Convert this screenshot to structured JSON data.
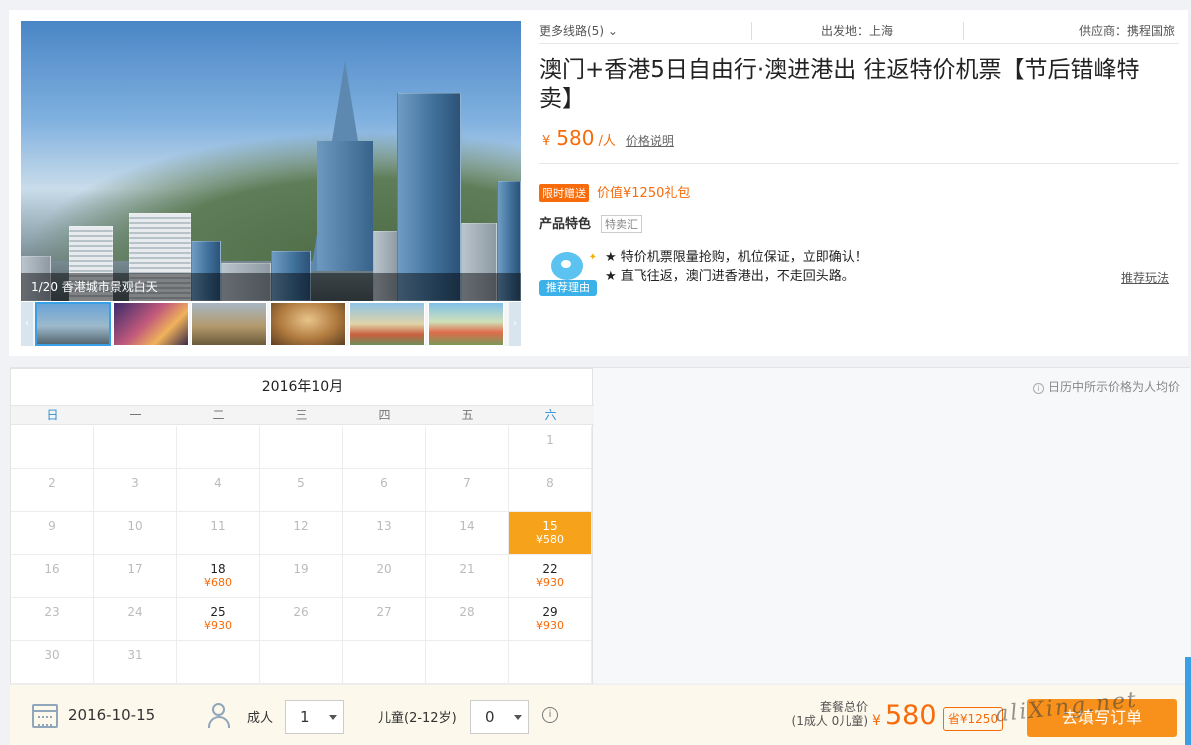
{
  "product": {
    "hero_caption": "1/20 香港城市景观白天",
    "more_routes": "更多线路(5)",
    "depart": "出发地：上海",
    "supplier": "供应商：携程国旅",
    "title": "澳门+香港5日自由行·澳进港出 往返特价机票【节后错峰特卖】",
    "price_symbol": "¥",
    "price": "580",
    "price_unit": "/人",
    "price_explain": "价格说明",
    "gift_tag": "限时赠送",
    "gift_text": "价值¥1250礼包",
    "feature_label": "产品特色",
    "feature_tag": "特卖汇",
    "reason_badge": "推荐理由",
    "reasons": [
      "★ 特价机票限量抢购，机位保证，立即确认！",
      "★ 直飞往返，澳门进香港出，不走回头路。"
    ],
    "recommend_link": "推荐玩法",
    "thumbnail_icons": [
      "skyline-thumb",
      "nightlife-thumb",
      "harbor-thumb",
      "ruins-thumb",
      "parade-thumb",
      "park-thumb"
    ]
  },
  "calendar": {
    "month_title": "2016年10月",
    "weekdays": [
      "日",
      "一",
      "二",
      "三",
      "四",
      "五",
      "六"
    ],
    "note": "日历中所示价格为人均价",
    "days": [
      {
        "d": "",
        "p": ""
      },
      {
        "d": "",
        "p": ""
      },
      {
        "d": "",
        "p": ""
      },
      {
        "d": "",
        "p": ""
      },
      {
        "d": "",
        "p": ""
      },
      {
        "d": "",
        "p": ""
      },
      {
        "d": "1",
        "p": ""
      },
      {
        "d": "2",
        "p": ""
      },
      {
        "d": "3",
        "p": ""
      },
      {
        "d": "4",
        "p": ""
      },
      {
        "d": "5",
        "p": ""
      },
      {
        "d": "6",
        "p": ""
      },
      {
        "d": "7",
        "p": ""
      },
      {
        "d": "8",
        "p": ""
      },
      {
        "d": "9",
        "p": ""
      },
      {
        "d": "10",
        "p": ""
      },
      {
        "d": "11",
        "p": ""
      },
      {
        "d": "12",
        "p": ""
      },
      {
        "d": "13",
        "p": ""
      },
      {
        "d": "14",
        "p": ""
      },
      {
        "d": "15",
        "p": "¥580",
        "selected": true
      },
      {
        "d": "16",
        "p": ""
      },
      {
        "d": "17",
        "p": ""
      },
      {
        "d": "18",
        "p": "¥680"
      },
      {
        "d": "19",
        "p": ""
      },
      {
        "d": "20",
        "p": ""
      },
      {
        "d": "21",
        "p": ""
      },
      {
        "d": "22",
        "p": "¥930"
      },
      {
        "d": "23",
        "p": ""
      },
      {
        "d": "24",
        "p": ""
      },
      {
        "d": "25",
        "p": "¥930"
      },
      {
        "d": "26",
        "p": ""
      },
      {
        "d": "27",
        "p": ""
      },
      {
        "d": "28",
        "p": ""
      },
      {
        "d": "29",
        "p": "¥930"
      },
      {
        "d": "30",
        "p": ""
      },
      {
        "d": "31",
        "p": ""
      },
      {
        "d": "",
        "p": ""
      },
      {
        "d": "",
        "p": ""
      },
      {
        "d": "",
        "p": ""
      },
      {
        "d": "",
        "p": ""
      },
      {
        "d": "",
        "p": ""
      }
    ]
  },
  "booking": {
    "date": "2016-10-15",
    "adult_label": "成人",
    "adult_value": "1",
    "child_label": "儿童(2-12岁)",
    "child_value": "0",
    "total_label": "套餐总价",
    "total_sub": "(1成人 0儿童)",
    "total_symbol": "¥",
    "total": "580",
    "save_badge": "省¥1250",
    "order_button": "去填写订单",
    "watermark": "aliXing.net"
  },
  "colors": {
    "accent": "#f76b0a",
    "selected_day": "#f7a21b",
    "button": "#f7911b",
    "link_blue": "#2b8ccf"
  }
}
